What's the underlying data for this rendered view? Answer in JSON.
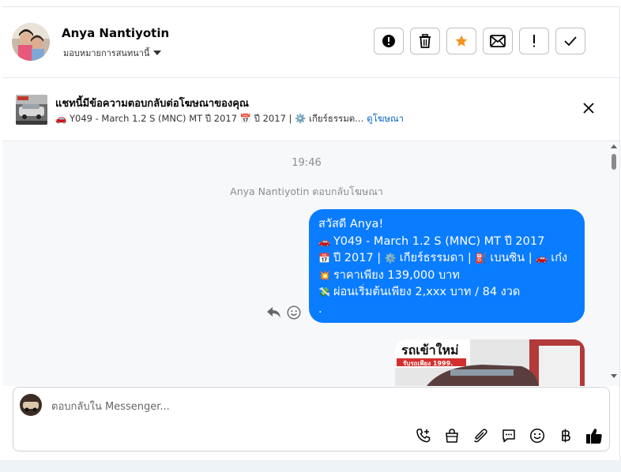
{
  "header": {
    "contact_name": "Anya Nantiyotin",
    "assign_label": "มอบหมายการสนทนานี้",
    "actions": [
      "mark-spam",
      "delete",
      "star",
      "mark-unread",
      "follow-up",
      "done"
    ]
  },
  "ad": {
    "title": "แชทนี้มีข้อความตอบกลับต่อโฆษณาของคุณ",
    "subtitle": "🚗 Y049 - March 1.2 S (MNC) MT ปี 2017 📅 ปี 2017 | ⚙️ เกียร์ธรรมด...",
    "link": "ดูโฆษณา"
  },
  "chat": {
    "timestamp": "19:46",
    "replied_note": "Anya Nantiyotin ตอบกลับโฆษณา",
    "bubble": {
      "line1": "สวัสดี Anya!",
      "line2": "Y049 - March 1.2 S (MNC) MT ปี 2017",
      "line3": "ปี 2017 | ",
      "line3b": "เกียร์ธรรมดา | ",
      "line3c": "เบนซิน | ",
      "line3d": "เก๋ง",
      "line4": "ราคาเพียง 139,000 บาท",
      "line5": "ผ่อนเริ่มต้นเพียง 2,xxx บาท / 84 งวด",
      "line6": "."
    },
    "image_caption": "รถเข้าใหม่",
    "image_sub": "รับรถเพียง 1999."
  },
  "composer": {
    "placeholder": "ตอบกลับใน Messenger..."
  },
  "colors": {
    "accent": "#0a7cff",
    "star": "#f7921e",
    "link": "#0a64c9"
  }
}
